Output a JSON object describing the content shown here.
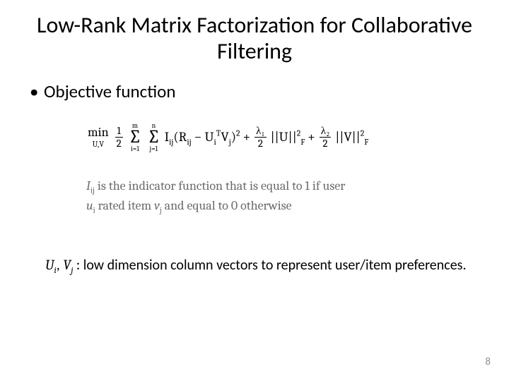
{
  "title": "Low-Rank Matrix Factorization for Collaborative Filtering",
  "bullet": "Objective function",
  "eq": {
    "min": "min",
    "minsub": "U,V",
    "half_num": "1",
    "half_den": "2",
    "sum1_top": "m",
    "sum1_bot": "i=1",
    "sum2_top": "n",
    "sum2_bot": "j=1",
    "t1a": "I",
    "t1a_sub": "ij",
    "t1b": "(R",
    "t1b_sub": "ij",
    "t1c": " − U",
    "t1c_sub": "i",
    "t1c_sup": "T",
    "t1d": "V",
    "t1d_sub": "j",
    "t1e": ")",
    "t1e_sup": "2",
    "plus1": " + ",
    "l1_num": "λ₁",
    "l1_den": "2",
    "u_norm_a": "||U||",
    "u_norm_sub": "F",
    "u_norm_sup": "2",
    "plus2": " + ",
    "l2_num": "λ₂",
    "l2_den": "2",
    "v_norm_a": "||V||",
    "v_norm_sub": "F",
    "v_norm_sup": "2"
  },
  "indicator": {
    "l1_a": "I",
    "l1_a_sub": "ij",
    "l1_b": " is the indicator function that is equal to 1 if user",
    "l2_a": "u",
    "l2_a_sub": "i",
    "l2_b": " rated item ",
    "l2_c": "v",
    "l2_c_sub": "j",
    "l2_d": " and equal to 0 otherwise"
  },
  "caption": {
    "m1": "U",
    "m1_sub": "i",
    "sep": ",  ",
    "m2": "V",
    "m2_sub": "j",
    "text": " : low dimension column vectors to represent user/item preferences."
  },
  "pagenum": "8"
}
